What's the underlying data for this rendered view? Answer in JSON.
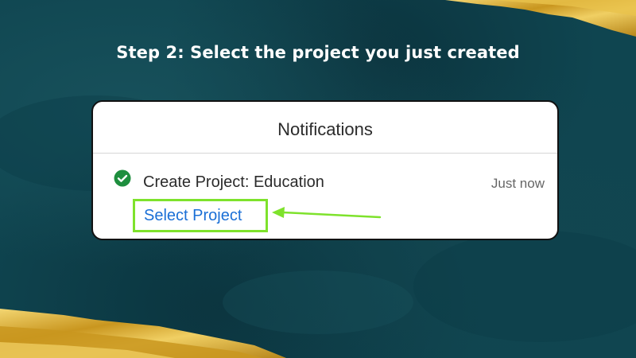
{
  "heading": "Step 2: Select the project you just created",
  "notifications": {
    "title": "Notifications",
    "items": [
      {
        "icon": "check-circle-icon",
        "title": "Create Project: Education",
        "time": "Just now",
        "action_label": "Select Project"
      }
    ]
  },
  "colors": {
    "background": "#0f4550",
    "gold_accent": "#d9b13a",
    "highlight": "#7ee22c",
    "link": "#1a6fd6",
    "success": "#1e8e3e"
  }
}
